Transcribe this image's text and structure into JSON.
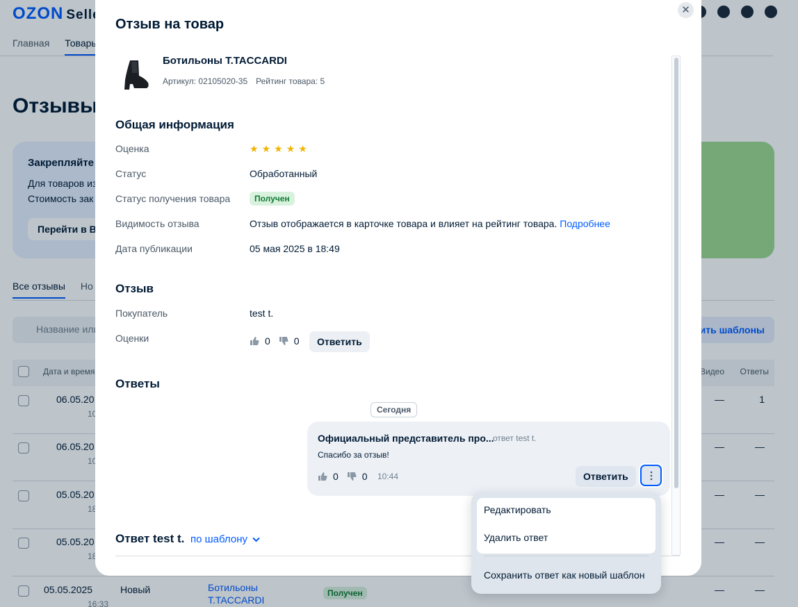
{
  "background": {
    "logo": "OZON",
    "logo_suffix": "Selle",
    "nav": [
      "Главная",
      "Товары"
    ],
    "page_title": "Отзывы",
    "banner": {
      "title": "Закрепляйте",
      "line1": "Для товаров из",
      "line2": "Стоимость зак",
      "button": "Перейти в Вы"
    },
    "tabs": [
      "Все отзывы",
      "Но"
    ],
    "search_placeholder": "Название или",
    "templates_button": "ить шаблоны",
    "table_headers": {
      "date": "Дата и время",
      "video": "Видео",
      "answers": "Ответы"
    },
    "rows": [
      {
        "date": "06.05.20",
        "time": "10",
        "video": "—",
        "answers": "1"
      },
      {
        "date": "06.05.20",
        "time": "10",
        "video": "—",
        "answers": "—"
      },
      {
        "date": "05.05.20",
        "time": "18",
        "video": "—",
        "answers": "—"
      },
      {
        "date": "05.05.20",
        "time": "18",
        "video": "—",
        "answers": "—"
      },
      {
        "date": "05.05.2025",
        "time": "16:33",
        "status": "Новый",
        "product": "Ботильоны T.TACCARDI",
        "badge": "Получен",
        "video": "—",
        "answers": "—"
      }
    ]
  },
  "modal": {
    "title": "Отзыв на товар",
    "product": {
      "name": "Ботильоны T.TACCARDI",
      "article": "Артикул: 02105020-35",
      "rating": "Рейтинг товара: 5"
    },
    "general": {
      "title": "Общая информация",
      "rating_label": "Оценка",
      "rating_value": 5,
      "status_label": "Статус",
      "status_value": "Обработанный",
      "receipt_label": "Статус получения товара",
      "receipt_value": "Получен",
      "visibility_label": "Видимость отзыва",
      "visibility_value": "Отзыв отображается в карточке товара и влияет на рейтинг товара.",
      "visibility_link": "Подробнее",
      "date_label": "Дата публикации",
      "date_value": "05 мая 2025 в 18:49"
    },
    "review": {
      "title": "Отзыв",
      "buyer_label": "Покупатель",
      "buyer_value": "test t.",
      "votes_label": "Оценки",
      "likes": "0",
      "dislikes": "0",
      "reply_button": "Ответить"
    },
    "answers": {
      "title": "Ответы",
      "date_chip": "Сегодня",
      "card": {
        "author": "Официальный представитель про...",
        "reply_to": "ответ test t.",
        "text": "Спасибо за отзыв!",
        "likes": "0",
        "dislikes": "0",
        "time": "10:44",
        "reply_button": "Ответить"
      }
    },
    "answer_form": {
      "title": "Ответ test t.",
      "template_link": "по шаблону"
    }
  },
  "dropdown": {
    "items": [
      "Редактировать",
      "Удалить ответ",
      "Сохранить ответ как новый шаблон"
    ]
  },
  "colors": {
    "accent": "#005bff",
    "star": "#f0b400",
    "badge_bg": "#d9f2de",
    "badge_text": "#0f7a32"
  }
}
